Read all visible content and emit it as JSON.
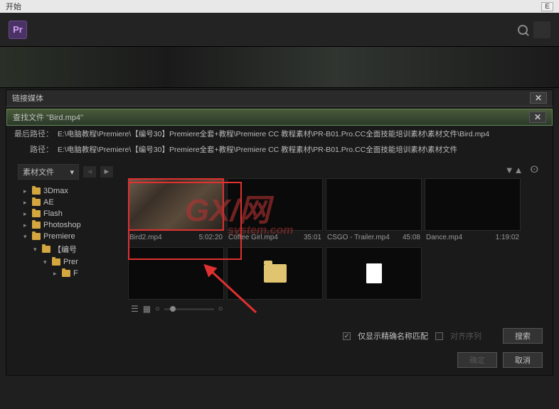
{
  "topbar": {
    "start": "开始",
    "right": "E"
  },
  "header": {
    "logo": "Pr"
  },
  "panels": {
    "link_media": {
      "title": "链接媒体",
      "close": "✕"
    },
    "find_file": {
      "title": "查找文件 \"Bird.mp4\"",
      "close": "✕"
    }
  },
  "paths": {
    "last_label": "最后路径：",
    "last_value": "E:\\电脑教程\\Premiere\\【编号30】Premiere全套+教程\\Premiere CC 教程素材\\PR-B01.Pro.CC全面技能培训素材\\素材文件\\Bird.mp4",
    "path_label": "路径：",
    "path_value": "E:\\电脑教程\\Premiere\\【编号30】Premiere全套+教程\\Premiere CC 教程素材\\PR-B01.Pro.CC全面技能培训素材\\素材文件"
  },
  "sidebar": {
    "dropdown": "素材文件",
    "items": [
      {
        "label": "3Dmax",
        "level": 1,
        "arrow": "▸"
      },
      {
        "label": "AE",
        "level": 1,
        "arrow": "▸"
      },
      {
        "label": "Flash",
        "level": 1,
        "arrow": "▸"
      },
      {
        "label": "Photoshop",
        "level": 1,
        "arrow": "▸"
      },
      {
        "label": "Premiere",
        "level": 1,
        "arrow": "▾"
      },
      {
        "label": "【编号",
        "level": 2,
        "arrow": "▾"
      },
      {
        "label": "Prer",
        "level": 3,
        "arrow": "▾"
      },
      {
        "label": "F",
        "level": 4,
        "arrow": "▸"
      }
    ]
  },
  "grid": {
    "items": [
      {
        "name": "Bird2.mp4",
        "duration": "5:02:20",
        "selected": true,
        "type": "video-bird"
      },
      {
        "name": "Coffee Girl.mp4",
        "duration": "35:01",
        "type": "video"
      },
      {
        "name": "CSGO - Trailer.mp4",
        "duration": "45:08",
        "type": "video"
      },
      {
        "name": "Dance.mp4",
        "duration": "1:19:02",
        "type": "video"
      },
      {
        "name": "",
        "duration": "",
        "type": "video"
      },
      {
        "name": "",
        "duration": "",
        "type": "folder"
      },
      {
        "name": "",
        "duration": "",
        "type": "doc"
      }
    ]
  },
  "footer": {
    "exact_match": "仅显示精确名称匹配",
    "align_seq": "对齐序列",
    "search": "搜索",
    "ok": "确定",
    "cancel": "取消"
  },
  "watermark": {
    "main": "GX/网",
    "sub": "system.com"
  }
}
